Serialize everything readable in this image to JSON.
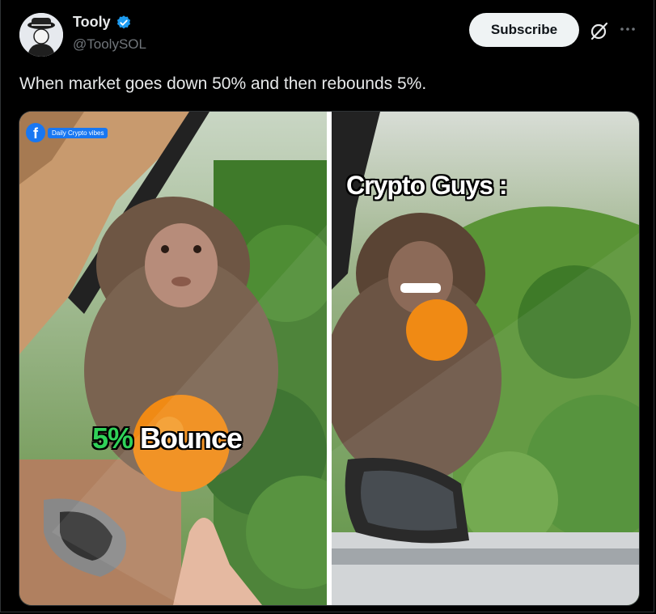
{
  "author": {
    "name": "Tooly",
    "handle": "@ToolySOL",
    "verified": true
  },
  "actions": {
    "subscribe_label": "Subscribe",
    "grok_icon": "grok-icon",
    "more_icon": "more-icon"
  },
  "tweet": {
    "text": "When market goes down 50% and then rebounds 5%."
  },
  "media": {
    "watermark": {
      "icon": "facebook-icon",
      "label": "Daily Crypto vibes"
    },
    "left_caption": {
      "highlight": "5%",
      "text": "Bounce"
    },
    "right_caption": {
      "text": "Crypto Guys :"
    }
  },
  "colors": {
    "background": "#000000",
    "subscribe_bg": "#eff3f4",
    "verified_blue": "#1d9bf0",
    "caption_green": "#30d158"
  }
}
